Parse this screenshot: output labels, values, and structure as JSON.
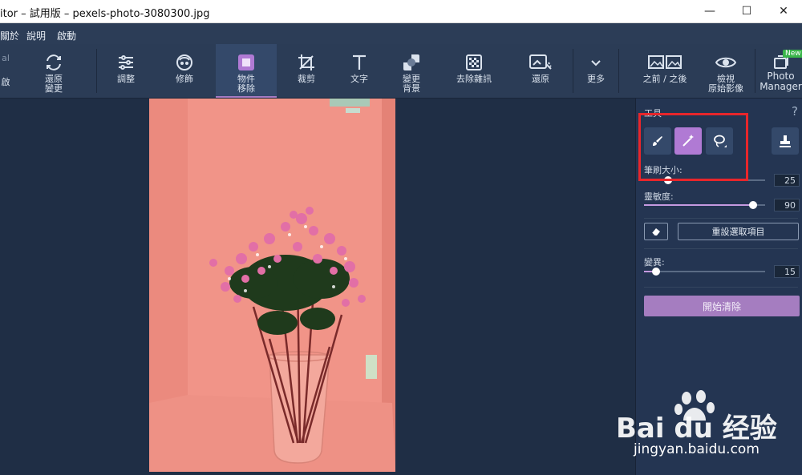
{
  "window": {
    "title": "itor – 試用版 – pexels-photo-3080300.jpg",
    "controls": {
      "minimize": "—",
      "maximize": "☐",
      "close": "✕"
    }
  },
  "menu": {
    "items": [
      "關於",
      "說明",
      "啟動"
    ]
  },
  "toolbar": {
    "partial_left": {
      "top": "al",
      "bottom": "啟"
    },
    "tools": [
      {
        "label": "還原\n變更",
        "icon": "refresh-icon"
      },
      {
        "label": "調整",
        "icon": "sliders-icon"
      },
      {
        "label": "修飾",
        "icon": "face-icon"
      },
      {
        "label": "物件\n移除",
        "icon": "object-removal-icon",
        "active": true
      },
      {
        "label": "裁剪",
        "icon": "crop-icon"
      },
      {
        "label": "文字",
        "icon": "text-icon"
      },
      {
        "label": "變更\n背景",
        "icon": "background-icon"
      },
      {
        "label": "去除雜訊",
        "icon": "denoise-icon"
      },
      {
        "label": "還原",
        "icon": "restore-icon"
      },
      {
        "label": "更多",
        "icon": "chevron-down-icon"
      },
      {
        "label": "之前 / 之後",
        "icon": "before-after-icon"
      },
      {
        "label": "檢視\n原始影像",
        "icon": "eye-icon"
      },
      {
        "label": "Photo\nManager",
        "icon": "photo-manager-icon",
        "badge": "New"
      }
    ]
  },
  "panel": {
    "tools_label": "工具",
    "help": "?",
    "brush_size_label": "筆刷大小:",
    "brush_size_value": "25",
    "sensitivity_label": "靈敏度:",
    "sensitivity_value": "90",
    "reset_label": "重設選取項目",
    "expand_label": "變異:",
    "expand_value": "15",
    "start_label": "開始清除",
    "slider_fractions": {
      "brush_size": 0.2,
      "sensitivity": 0.9,
      "expand": 0.1
    }
  },
  "watermark": {
    "logo": "Bai du 经验",
    "url": "jingyan.baidu.com"
  },
  "colors": {
    "accent": "#a57dc0",
    "selected_tool": "#b07ad4",
    "highlight_box": "#e8262b",
    "photo_tint": "#ee8c80"
  }
}
